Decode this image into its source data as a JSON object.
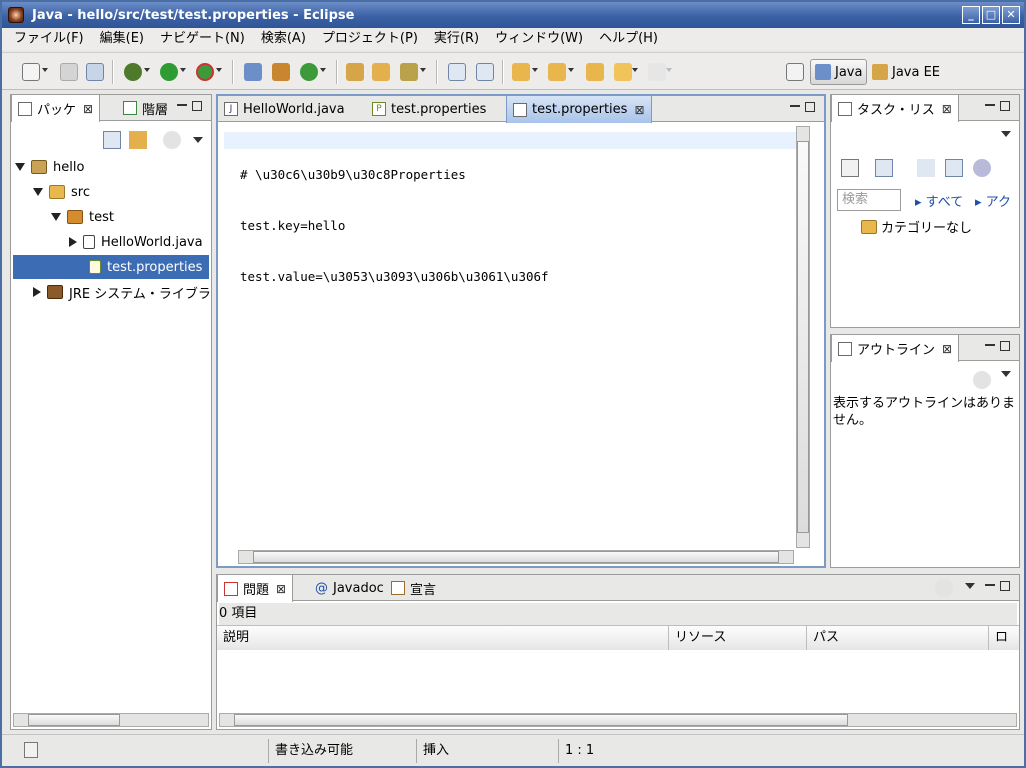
{
  "window": {
    "title": "Java - hello/src/test/test.properties - Eclipse"
  },
  "menubar": [
    "ファイル(F)",
    "編集(E)",
    "ナビゲート(N)",
    "検索(A)",
    "プロジェクト(P)",
    "実行(R)",
    "ウィンドウ(W)",
    "ヘルプ(H)"
  ],
  "toolbar": {
    "perspectives": [
      {
        "label": "Java",
        "active": true
      },
      {
        "label": "Java EE",
        "active": false
      }
    ]
  },
  "left_panel": {
    "tabs": [
      "パッケ",
      "階層"
    ],
    "tree": [
      {
        "label": "hello",
        "icon": "project-icon",
        "expanded": true
      },
      {
        "label": "src",
        "icon": "source-folder-icon",
        "expanded": true
      },
      {
        "label": "test",
        "icon": "package-icon",
        "expanded": true
      },
      {
        "label": "HelloWorld.java",
        "icon": "java-file-icon",
        "expanded": false
      },
      {
        "label": "test.properties",
        "icon": "properties-file-icon",
        "selected": true
      },
      {
        "label": "JRE システム・ライブラ",
        "icon": "library-icon",
        "expanded": false
      }
    ]
  },
  "editor": {
    "tabs": [
      "HelloWorld.java",
      "test.properties",
      "test.properties"
    ],
    "lines": [
      "# \\u30c6\\u30b9\\u30c8Properties",
      "test.key=hello",
      "test.value=\\u3053\\u3093\\u306b\\u3061\\u306f"
    ]
  },
  "task_panel": {
    "title": "タスク・リス",
    "search_placeholder": "検索",
    "filter_all": "すべて",
    "filter_act": "アク",
    "category": "カテゴリーなし"
  },
  "outline_panel": {
    "title": "アウトライン",
    "message": "表示するアウトラインはありません。"
  },
  "bottom_panel": {
    "tabs": [
      "問題",
      "Javadoc",
      "宣言"
    ],
    "summary": "0 項目",
    "columns": [
      "説明",
      "リソース",
      "パス",
      "ロケ"
    ]
  },
  "statusbar": {
    "writable": "書き込み可能",
    "insert_mode": "挿入",
    "position": "1 : 1"
  }
}
